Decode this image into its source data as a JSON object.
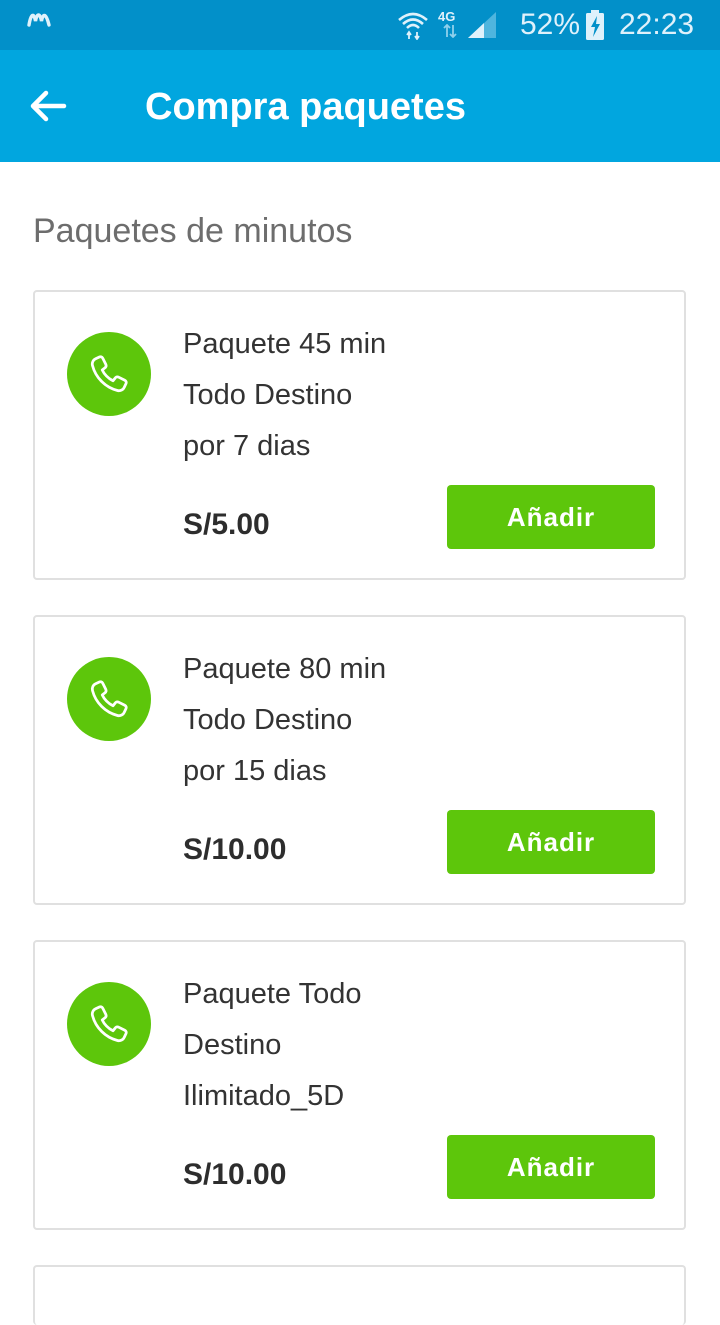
{
  "status_bar": {
    "network": "4G",
    "battery": "52%",
    "time": "22:23"
  },
  "app_bar": {
    "title": "Compra paquetes",
    "back_icon": "arrow-left-icon"
  },
  "section": {
    "title": "Paquetes de minutos"
  },
  "packages": [
    {
      "lines": [
        "Paquete 45 min",
        "Todo Destino",
        "por 7 dias"
      ],
      "price": "S/5.00",
      "button": "Añadir",
      "icon": "phone-icon"
    },
    {
      "lines": [
        "Paquete 80 min",
        "Todo Destino",
        "por 15 dias"
      ],
      "price": "S/10.00",
      "button": "Añadir",
      "icon": "phone-icon"
    },
    {
      "lines": [
        "Paquete Todo",
        "Destino",
        "Ilimitado_5D"
      ],
      "price": "S/10.00",
      "button": "Añadir",
      "icon": "phone-icon"
    }
  ],
  "colors": {
    "status_bar": "#0290c9",
    "app_bar": "#01a6df",
    "accent_green": "#5dc60b"
  }
}
